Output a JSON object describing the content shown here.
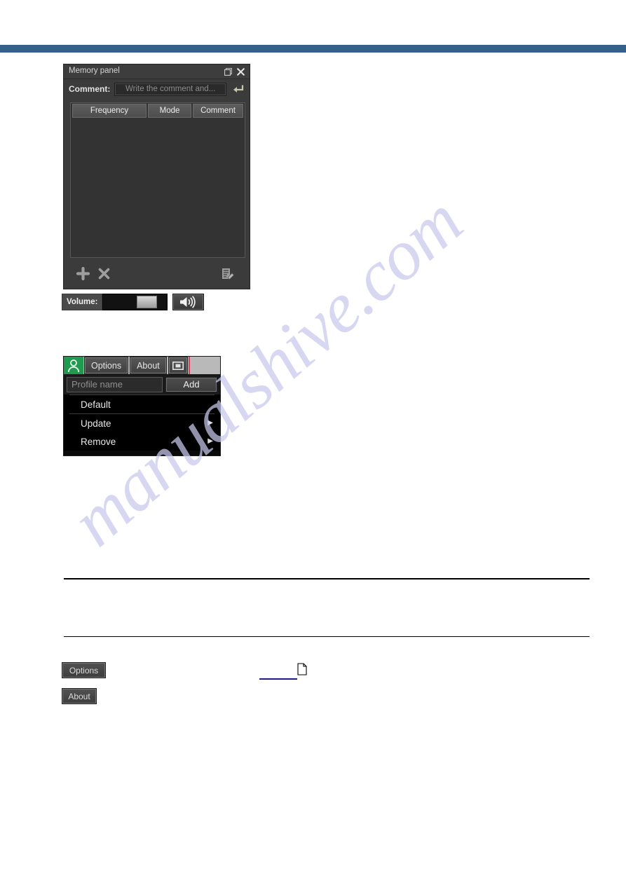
{
  "page": {
    "accent_bar_color": "#34608b",
    "watermark_text": "manualshive.com"
  },
  "memory_panel": {
    "title": "Memory panel",
    "titlebar_buttons": [
      {
        "name": "float-icon",
        "label": "❐"
      },
      {
        "name": "close-icon",
        "label": "✕"
      }
    ],
    "comment_label": "Comment:",
    "comment_placeholder": "Write the comment and...",
    "enter_button_label": "↵",
    "table": {
      "columns": [
        "Frequency",
        "Mode",
        "Comment"
      ],
      "rows": []
    },
    "footer": {
      "add_label": "＋",
      "remove_label": "✕",
      "edit_label": "edit-document-icon"
    }
  },
  "volume": {
    "label": "Volume:",
    "value_percent": 52,
    "speaker_icon": "speaker-icon"
  },
  "profile_panel": {
    "toolbar": {
      "profile_icon": "profile-icon",
      "options_label": "Options",
      "about_label": "About",
      "window_icon": "window-icon",
      "accent_color": "#e04060"
    },
    "name_placeholder": "Profile name",
    "add_label": "Add",
    "menu_items": [
      {
        "label": "Default",
        "has_submenu": false
      },
      {
        "label": "Update",
        "has_submenu": true,
        "arrow": "▶"
      },
      {
        "label": "Remove",
        "has_submenu": true,
        "arrow": "▶"
      }
    ]
  },
  "bottom_buttons": {
    "options_label": "Options",
    "about_label": "About"
  },
  "link": {
    "underline_color": "#1b1b8f"
  }
}
